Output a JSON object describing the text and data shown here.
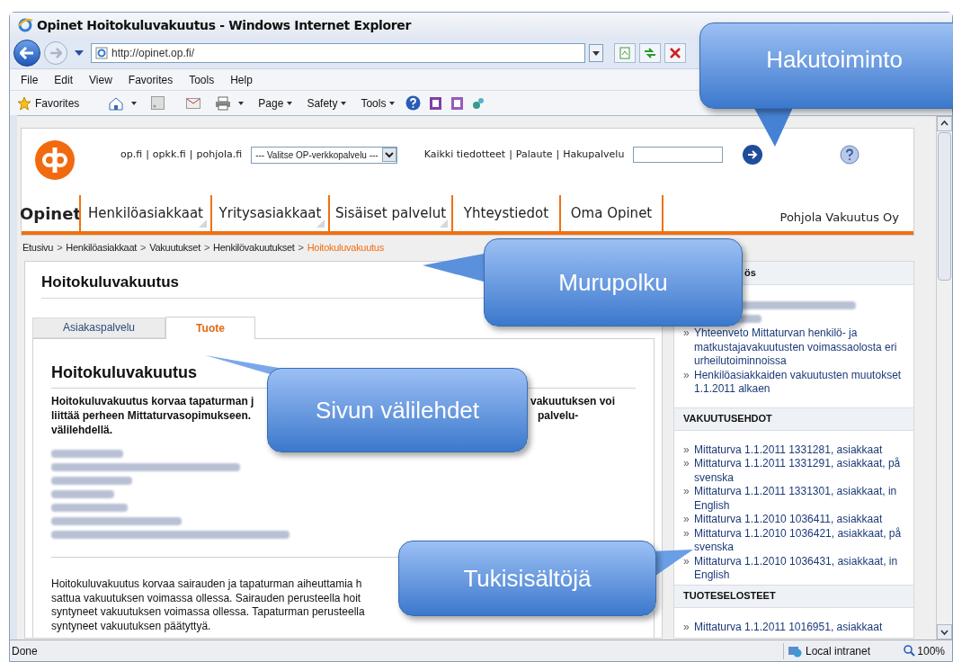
{
  "window": {
    "title": "Opinet Hoitokuluvakuutus - Windows Internet Explorer"
  },
  "address_bar": {
    "url": "http://opinet.op.fi/"
  },
  "menu_bar": [
    "File",
    "Edit",
    "View",
    "Favorites",
    "Tools",
    "Help"
  ],
  "command_bar": {
    "favorites": "Favorites",
    "menus": [
      "Page",
      "Safety",
      "Tools"
    ]
  },
  "site_header": {
    "top_links": [
      "op.fi",
      "opkk.fi",
      "pohjola.fi"
    ],
    "separator": "|",
    "service_select": "--- Valitse OP-verkkopalvelu ---",
    "right_links": [
      "Kaikki tiedotteet",
      "Palaute",
      "Hakupalvelu"
    ],
    "nav": [
      {
        "label": "Opinet",
        "kind": "brand",
        "has_submenu": false
      },
      {
        "label": "Henkilöasiakkaat",
        "kind": "item",
        "has_submenu": true
      },
      {
        "label": "Yritysasiakkaat",
        "kind": "item",
        "has_submenu": true
      },
      {
        "label": "Sisäiset palvelut",
        "kind": "item",
        "has_submenu": true
      },
      {
        "label": "Yhteystiedot",
        "kind": "item",
        "has_submenu": false
      },
      {
        "label": "Oma Opinet",
        "kind": "item",
        "has_submenu": false
      }
    ],
    "company": "Pohjola Vakuutus Oy"
  },
  "breadcrumb": {
    "separator": ">",
    "items": [
      {
        "label": "Etusivu",
        "current": false
      },
      {
        "label": "Henkilöasiakkaat",
        "current": false
      },
      {
        "label": "Vakuutukset",
        "current": false
      },
      {
        "label": "Henkilövakuutukset",
        "current": false
      },
      {
        "label": "Hoitokuluvakuutus",
        "current": true
      }
    ]
  },
  "main": {
    "page_title": "Hoitokuluvakuutus",
    "tabs": [
      {
        "label": "Asiakaspalvelu",
        "selected": false
      },
      {
        "label": "Tuote",
        "selected": true
      }
    ],
    "heading": "Hoitokuluvakuutus",
    "intro_lines": [
      {
        "left": "Hoitokuluvakuutus korvaa tapaturman j",
        "right": "vakuutuksen voi"
      },
      {
        "left": "liittää perheen Mittaturvasopimukseen.",
        "right": "palvelu-"
      },
      {
        "left": "välilehdellä."
      }
    ],
    "links": [
      {
        "kind": "blurred"
      },
      {
        "kind": "blurred"
      },
      {
        "kind": "blurred"
      },
      {
        "kind": "blurred"
      },
      {
        "kind": "blurred"
      },
      {
        "kind": "blurred"
      },
      {
        "kind": "blurred"
      }
    ],
    "paragraph_lines": [
      "Hoitokuluvakuutus korvaa sairauden ja tapaturman aiheuttamia h",
      "sattua vakuutuksen voimassa ollessa. Sairauden perusteella hoit",
      "syntyneet vakuutuksen voimassa ollessa. Tapaturman perusteella",
      "syntyneet vakuutuksen päätyttyä."
    ]
  },
  "sidebar": {
    "bullet": "»",
    "sections": [
      {
        "heading": "ös",
        "items": [
          {
            "kind": "blurred"
          },
          {
            "kind": "link",
            "text": "Yhteenveto Mittaturvan henkilö- ja matkustajavakuutusten voimassaolosta eri urheilutoiminnoissa"
          },
          {
            "kind": "link",
            "text": "Henkilöasiakkaiden vakuutusten muutokset 1.1.2011 alkaen"
          }
        ]
      },
      {
        "heading": "VAKUUTUSEHDOT",
        "items": [
          {
            "kind": "link",
            "text": "Mittaturva 1.1.2011 1331281, asiakkaat"
          },
          {
            "kind": "link",
            "text": "Mittaturva 1.1.2011 1331291, asiakkaat, på svenska"
          },
          {
            "kind": "link",
            "text": "Mittaturva 1.1.2011 1331301, asiakkaat, in English"
          },
          {
            "kind": "link",
            "text": "Mittaturva 1.1.2010 1036411, asiakkaat"
          },
          {
            "kind": "link",
            "text": "Mittaturva 1.1.2010 1036421, asiakkaat, på svenska"
          },
          {
            "kind": "link",
            "text": "Mittaturva 1.1.2010 1036431, asiakkaat, in English"
          }
        ]
      },
      {
        "heading": "TUOTESELOSTEET",
        "items": [
          {
            "kind": "link",
            "text": "Mittaturva 1.1.2011 1016951, asiakkaat"
          }
        ]
      }
    ]
  },
  "status_bar": {
    "status": "Done",
    "zone": "Local intranet",
    "zoom": "100%"
  },
  "callouts": [
    {
      "text": "Hakutoiminto"
    },
    {
      "text": "Murupolku"
    },
    {
      "text": "Sivun välilehdet"
    },
    {
      "text": "Tukisisältöjä"
    }
  ]
}
